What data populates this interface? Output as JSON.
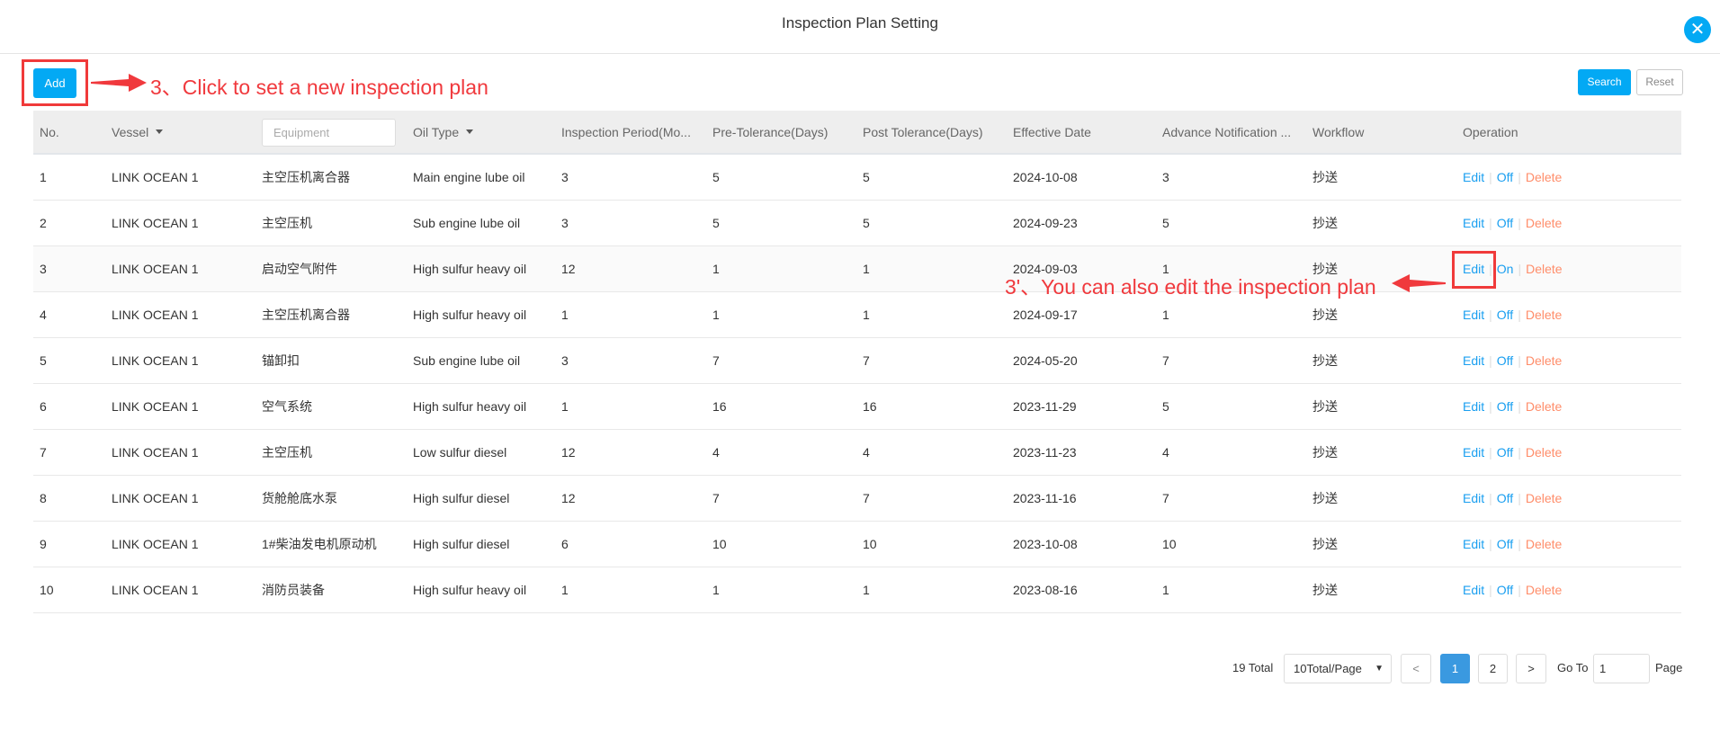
{
  "dialog": {
    "title": "Inspection Plan Setting",
    "close_icon": "close-icon"
  },
  "toolbar": {
    "add_label": "Add",
    "search_label": "Search",
    "reset_label": "Reset"
  },
  "annotations": {
    "add_note": "3、Click to set a new inspection plan",
    "edit_note": "3'、You can also edit the inspection plan"
  },
  "colors": {
    "primary": "#03a9f4",
    "annotation": "#f0393d",
    "link": "#1a9ff0",
    "delete": "#ff8d6a",
    "active_page": "#3a99e0"
  },
  "table": {
    "headers": {
      "no": "No.",
      "vessel": "Vessel",
      "equipment_placeholder": "Equipment",
      "oil_type": "Oil Type",
      "period": "Inspection Period(Mo...",
      "pre": "Pre-Tolerance(Days)",
      "post": "Post Tolerance(Days)",
      "date": "Effective Date",
      "advance": "Advance Notification ...",
      "workflow": "Workflow",
      "operation": "Operation"
    },
    "rows": [
      {
        "no": "1",
        "vessel": "LINK OCEAN 1",
        "equipment": "主空压机离合器",
        "oil": "Main engine lube oil",
        "period": "3",
        "pre": "5",
        "post": "5",
        "date": "2024-10-08",
        "advance": "3",
        "workflow": "抄送",
        "edit": "Edit",
        "toggle": "Off",
        "delete": "Delete"
      },
      {
        "no": "2",
        "vessel": "LINK OCEAN 1",
        "equipment": "主空压机",
        "oil": "Sub engine lube oil",
        "period": "3",
        "pre": "5",
        "post": "5",
        "date": "2024-09-23",
        "advance": "5",
        "workflow": "抄送",
        "edit": "Edit",
        "toggle": "Off",
        "delete": "Delete"
      },
      {
        "no": "3",
        "vessel": "LINK OCEAN 1",
        "equipment": "启动空气附件",
        "oil": "High sulfur heavy oil",
        "period": "12",
        "pre": "1",
        "post": "1",
        "date": "2024-09-03",
        "advance": "1",
        "workflow": "抄送",
        "edit": "Edit",
        "toggle": "On",
        "delete": "Delete"
      },
      {
        "no": "4",
        "vessel": "LINK OCEAN 1",
        "equipment": "主空压机离合器",
        "oil": "High sulfur heavy oil",
        "period": "1",
        "pre": "1",
        "post": "1",
        "date": "2024-09-17",
        "advance": "1",
        "workflow": "抄送",
        "edit": "Edit",
        "toggle": "Off",
        "delete": "Delete"
      },
      {
        "no": "5",
        "vessel": "LINK OCEAN 1",
        "equipment": "锚卸扣",
        "oil": "Sub engine lube oil",
        "period": "3",
        "pre": "7",
        "post": "7",
        "date": "2024-05-20",
        "advance": "7",
        "workflow": "抄送",
        "edit": "Edit",
        "toggle": "Off",
        "delete": "Delete"
      },
      {
        "no": "6",
        "vessel": "LINK OCEAN 1",
        "equipment": "空气系统",
        "oil": "High sulfur heavy oil",
        "period": "1",
        "pre": "16",
        "post": "16",
        "date": "2023-11-29",
        "advance": "5",
        "workflow": "抄送",
        "edit": "Edit",
        "toggle": "Off",
        "delete": "Delete"
      },
      {
        "no": "7",
        "vessel": "LINK OCEAN 1",
        "equipment": "主空压机",
        "oil": "Low sulfur diesel",
        "period": "12",
        "pre": "4",
        "post": "4",
        "date": "2023-11-23",
        "advance": "4",
        "workflow": "抄送",
        "edit": "Edit",
        "toggle": "Off",
        "delete": "Delete"
      },
      {
        "no": "8",
        "vessel": "LINK OCEAN 1",
        "equipment": "货舱舱底水泵",
        "oil": "High sulfur diesel",
        "period": "12",
        "pre": "7",
        "post": "7",
        "date": "2023-11-16",
        "advance": "7",
        "workflow": "抄送",
        "edit": "Edit",
        "toggle": "Off",
        "delete": "Delete"
      },
      {
        "no": "9",
        "vessel": "LINK OCEAN 1",
        "equipment": "1#柴油发电机原动机",
        "oil": "High sulfur diesel",
        "period": "6",
        "pre": "10",
        "post": "10",
        "date": "2023-10-08",
        "advance": "10",
        "workflow": "抄送",
        "edit": "Edit",
        "toggle": "Off",
        "delete": "Delete"
      },
      {
        "no": "10",
        "vessel": "LINK OCEAN 1",
        "equipment": "消防员装备",
        "oil": "High sulfur heavy oil",
        "period": "1",
        "pre": "1",
        "post": "1",
        "date": "2023-08-16",
        "advance": "1",
        "workflow": "抄送",
        "edit": "Edit",
        "toggle": "Off",
        "delete": "Delete"
      }
    ]
  },
  "pagination": {
    "total": "19 Total",
    "page_size": "10Total/Page",
    "prev": "<",
    "pages": [
      "1",
      "2"
    ],
    "current": "1",
    "next": ">",
    "goto_label": "Go To",
    "goto_value": "1",
    "page_label": "Page"
  }
}
